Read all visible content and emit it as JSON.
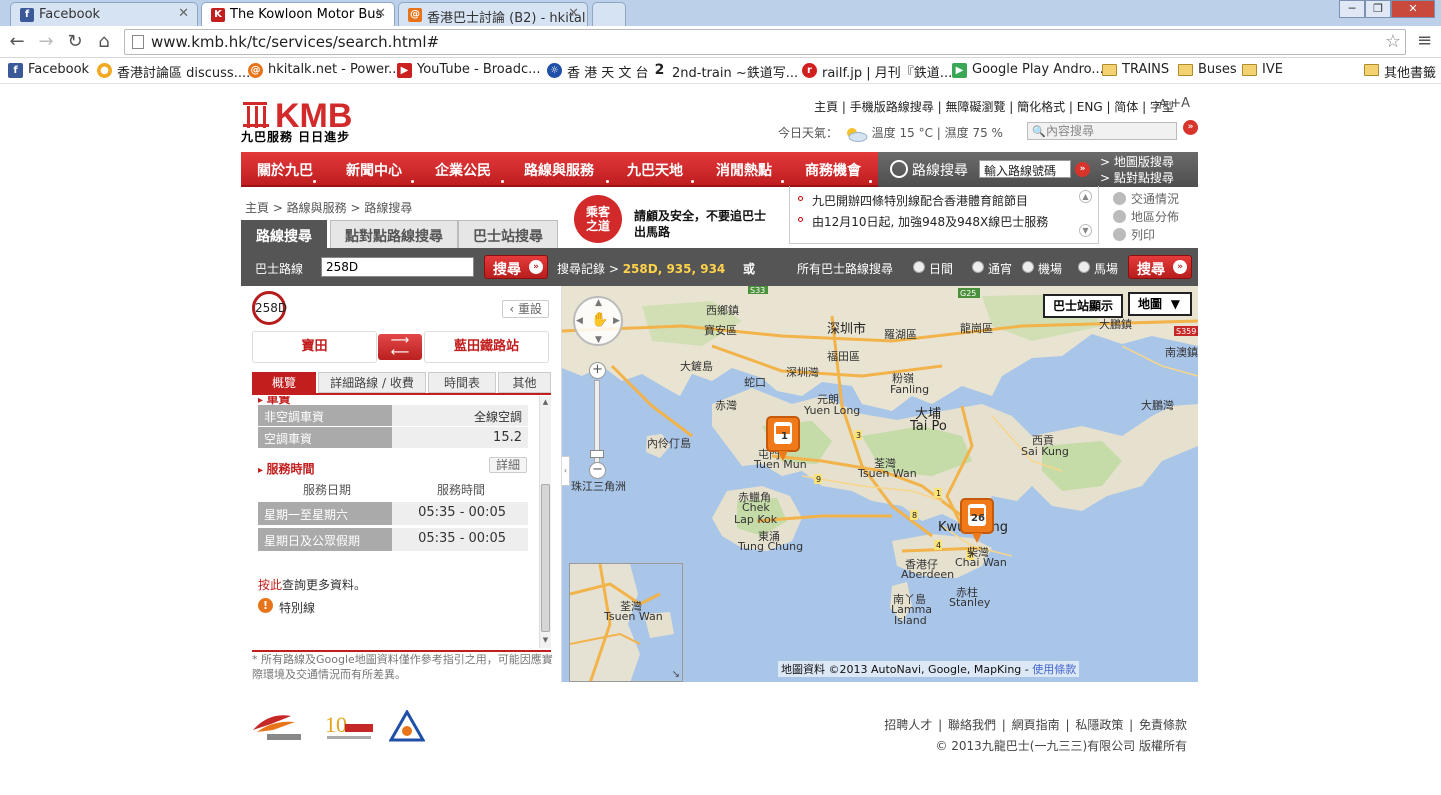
{
  "browser": {
    "tabs": [
      {
        "label": "Facebook",
        "icon": "facebook-icon",
        "color": "#3b5998",
        "glyph": "f"
      },
      {
        "label": "The Kowloon Motor Bus",
        "icon": "kmb-icon",
        "color": "#c21e1e",
        "glyph": "K"
      },
      {
        "label": "香港巴士討論 (B2) - hkital",
        "icon": "hkitalk-icon",
        "color": "#e8741a",
        "glyph": "@"
      }
    ],
    "url": "www.kmb.hk/tc/services/search.html#",
    "bookmarks": [
      {
        "label": "Facebook",
        "color": "#3b5998",
        "glyph": "f"
      },
      {
        "label": "香港討論區 discuss....",
        "color": "#f2a91f",
        "glyph": "●"
      },
      {
        "label": "hkitalk.net - Power...",
        "color": "#e8741a",
        "glyph": "@"
      },
      {
        "label": "YouTube - Broadc...",
        "color": "#cc1f1f",
        "glyph": "▶"
      },
      {
        "label": "香 港 天 文 台",
        "color": "#1f4fa6",
        "glyph": "☼"
      },
      {
        "label": "2nd-train ~鉄道写...",
        "color": "#222",
        "glyph": "2"
      },
      {
        "label": "railf.jp | 月刊『鉄道...",
        "color": "#d21f1f",
        "glyph": "r"
      },
      {
        "label": "Google Play Andro...",
        "color": "#3aa757",
        "glyph": "▶"
      },
      {
        "label": "TRAINS",
        "folder": true
      },
      {
        "label": "Buses",
        "folder": true
      },
      {
        "label": "IVE",
        "folder": true
      }
    ],
    "other_bookmarks": "其他書籤"
  },
  "header": {
    "logo_sub": "九巴服務 日日進步",
    "toplinks": "主頁 | 手機版路線搜尋 | 無障礙瀏覽 | 簡化格式 | ENG | 简体 | 字型",
    "font_small": "-A",
    "font_big": "+A",
    "weather": "今日天氣：",
    "temp": "溫度 15 °C | 濕度 75 %",
    "site_search_placeholder": "內容搜尋"
  },
  "nav": {
    "items": [
      "關於九巴",
      "新聞中心",
      "企業公民",
      "路線與服務",
      "九巴天地",
      "消閒熱點",
      "商務機會"
    ],
    "route_search": "路線搜尋",
    "route_input": "輸入路線號碼",
    "map_search": "> 地圖版搜尋",
    "p2p_search": "> 點對點搜尋"
  },
  "breadcrumb": "主頁 > 路線與服務 > 路線搜尋",
  "search_tabs": [
    "路線搜尋",
    "點對點路線搜尋",
    "巴士站搜尋"
  ],
  "safety": {
    "badge": "乘客之道",
    "text": "請顧及安全，不要追巴士出馬路"
  },
  "news": [
    "九巴開辦四條特別線配合香港體育館節目",
    "由12月10日起, 加強948及948X線巴士服務"
  ],
  "sidetools": [
    "交通情況",
    "地區分佈",
    "列印"
  ],
  "searchbar": {
    "label": "巴士路線",
    "value": "258D",
    "button": "搜尋",
    "history_label": "搜尋記錄 >",
    "history": "258D, 935, 934",
    "or": "或",
    "all_label": "所有巴士路線搜尋",
    "radios": [
      "日間",
      "通宵",
      "機場",
      "馬場"
    ]
  },
  "route": {
    "number": "258D",
    "reset": "重設",
    "from": "寶田",
    "to": "藍田鐵路站",
    "tabs": [
      "概覽",
      "詳細路線 / 收費",
      "時間表",
      "其他"
    ],
    "fare_section": "車資",
    "fares": [
      {
        "k": "非空調車資",
        "v": "全線空調"
      },
      {
        "k": "空調車資",
        "v": "15.2"
      }
    ],
    "service_section": "服務時間",
    "detail": "詳細",
    "col_date": "服務日期",
    "col_time": "服務時間",
    "times": [
      {
        "k": "星期一至星期六",
        "v": "05:35 - 00:05"
      },
      {
        "k": "星期日及公眾假期",
        "v": "05:35 - 00:05"
      }
    ],
    "more_link": "按此",
    "more_text": "查詢更多資料。",
    "special": "特別線",
    "disclaimer": "* 所有路線及Google地圖資料僅作參考指引之用，可能因應實際環境及交通情況而有所差異。"
  },
  "map": {
    "show_stops": "巴士站顯示",
    "type": "地圖",
    "copyright": "地圖資料 ©2013 AutoNavi, Google, MapKing - ",
    "terms": "使用條款",
    "labels": [
      {
        "t": "西鄉鎮",
        "big": false
      },
      {
        "t": "寶安區",
        "big": false
      },
      {
        "t": "深圳市",
        "big": true
      },
      {
        "t": "羅湖區",
        "big": false
      },
      {
        "t": "龍崗區",
        "big": false
      },
      {
        "t": "大鵬鎮",
        "big": false
      },
      {
        "t": "福田區",
        "big": false
      },
      {
        "t": "南澳鎮",
        "big": false
      },
      {
        "t": "大鏟島",
        "big": false
      },
      {
        "t": "深圳灣",
        "big": false
      },
      {
        "t": "蛇口",
        "big": false
      },
      {
        "t": "粉嶺",
        "big": false
      },
      {
        "t": "Fanling",
        "big": false
      },
      {
        "t": "元朗",
        "big": false
      },
      {
        "t": "Yuen Long",
        "big": false
      },
      {
        "t": "赤灣",
        "big": false
      },
      {
        "t": "大埔",
        "big": true
      },
      {
        "t": "Tai Po",
        "big": true
      },
      {
        "t": "大鵬灣",
        "big": false
      },
      {
        "t": "內伶仃島",
        "big": false
      },
      {
        "t": "屯門",
        "big": false
      },
      {
        "t": "Tuen Mun",
        "big": false
      },
      {
        "t": "西貢",
        "big": false
      },
      {
        "t": "Sai Kung",
        "big": false
      },
      {
        "t": "荃灣",
        "big": false
      },
      {
        "t": "Tsuen Wan",
        "big": false
      },
      {
        "t": "珠江三角洲",
        "big": false
      },
      {
        "t": "赤鱲角",
        "big": false
      },
      {
        "t": "Chek",
        "big": false
      },
      {
        "t": "Lap Kok",
        "big": false
      },
      {
        "t": "東涌",
        "big": false
      },
      {
        "t": "Tung Chung",
        "big": false
      },
      {
        "t": "Kwun Tong",
        "big": true
      },
      {
        "t": "柴灣",
        "big": false
      },
      {
        "t": "Chai Wan",
        "big": false
      },
      {
        "t": "香港仔",
        "big": false
      },
      {
        "t": "Aberdeen",
        "big": false
      },
      {
        "t": "南丫島",
        "big": false
      },
      {
        "t": "Lamma",
        "big": false
      },
      {
        "t": "Island",
        "big": false
      },
      {
        "t": "赤柱",
        "big": false
      },
      {
        "t": "Stanley",
        "big": false
      }
    ],
    "overview_labels": [
      "荃灣",
      "Tsuen Wan"
    ],
    "marker1": "1",
    "marker2": "26"
  },
  "footer": {
    "links": "招聘人才 | 聯絡我們 | 網頁指南 | 私隱政策 | 免責條款",
    "copyright": "© 2013九龍巴士(一九三三)有限公司 版權所有"
  }
}
